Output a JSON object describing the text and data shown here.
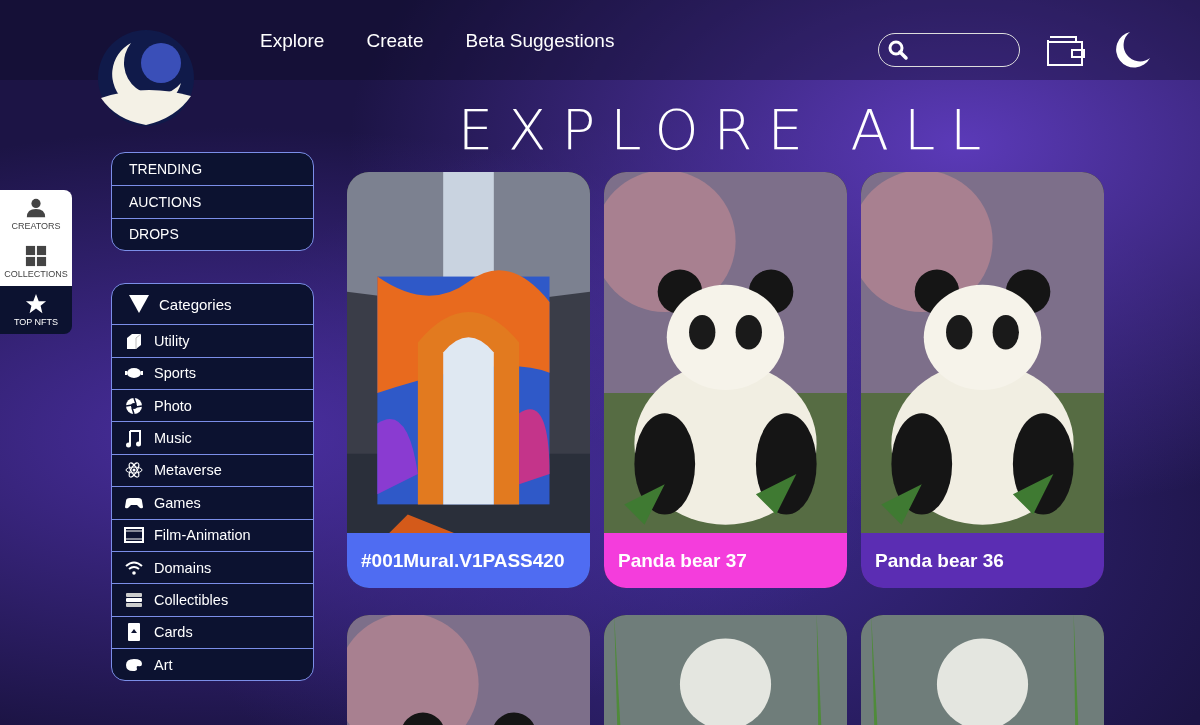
{
  "nav": {
    "links": [
      "Explore",
      "Create",
      "Beta Suggestions"
    ]
  },
  "side_tabs": [
    {
      "label": "CREATORS",
      "selected": false
    },
    {
      "label": "COLLECTIONS",
      "selected": false
    },
    {
      "label": "TOP NFTS",
      "selected": true
    }
  ],
  "filters": [
    "TRENDING",
    "AUCTIONS",
    "DROPS"
  ],
  "categories": {
    "title": "Categories",
    "expanded": true,
    "items": [
      "Utility",
      "Sports",
      "Photo",
      "Music",
      "Metaverse",
      "Games",
      "Film-Animation",
      "Domains",
      "Collectibles",
      "Cards",
      "Art"
    ]
  },
  "heading": "EXPLORE ALL",
  "cards": [
    {
      "title": "#001Mural.V1PASS420",
      "color": "#4f6cf2",
      "kind": "picture"
    },
    {
      "title": "Panda bear 37",
      "color": "#f43ddc",
      "kind": "picture"
    },
    {
      "title": "Panda bear 36",
      "color": "#5b2db3",
      "kind": "picture"
    },
    {
      "kind": "picture"
    },
    {
      "kind": "picture"
    },
    {
      "kind": "picture"
    }
  ]
}
